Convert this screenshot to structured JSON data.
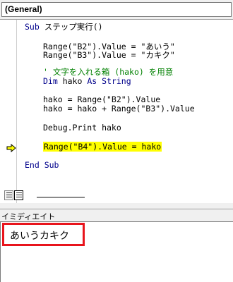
{
  "procedure_dropdown": {
    "value": "(General)"
  },
  "code": {
    "sub_keyword": "Sub",
    "sub_name": "ステップ実行()",
    "line_b2": "Range(\"B2\").Value = \"あいう\"",
    "line_b3": "Range(\"B3\").Value = \"カキク\"",
    "comment": "' 文字を入れる箱 (hako) を用意",
    "dim_keyword": "Dim",
    "dim_name": " hako ",
    "as_keyword": "As",
    "string_keyword": " String",
    "line_hako1": "hako = Range(\"B2\").Value",
    "line_hako2": "hako = hako + Range(\"B3\").Value",
    "debug_print": "Debug.Print hako",
    "current_line": "Range(\"B4\").Value = hako",
    "end_keyword": "End",
    "end_sub": " Sub"
  },
  "immediate_window": {
    "title": "イミディエイト",
    "output": "あいうカキク"
  },
  "colors": {
    "keyword": "#00008b",
    "comment": "#008000",
    "current_line_highlight": "#ffff00",
    "annotation_box": "#e8141c"
  }
}
